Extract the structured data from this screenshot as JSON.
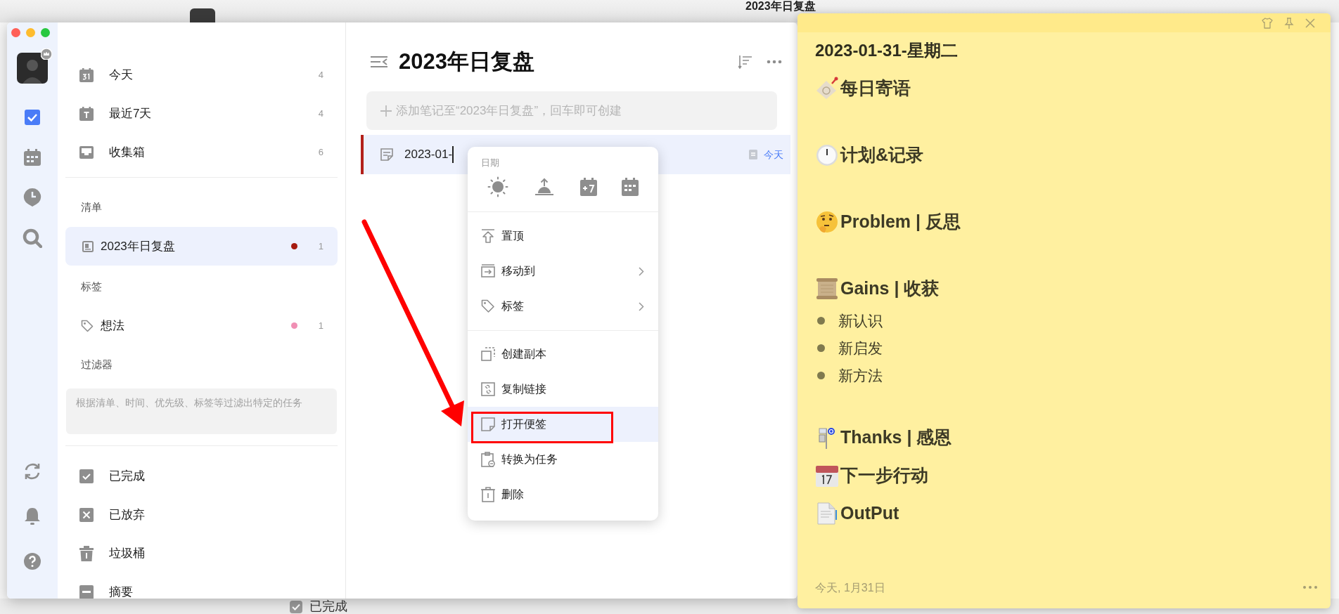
{
  "background_window": {
    "title": "2023年日复盘",
    "footer_item": {
      "label": "已完成",
      "checked": true
    }
  },
  "rail": {
    "items": [
      {
        "selected": true
      },
      {
        "selected": false
      },
      {
        "selected": false
      },
      {
        "selected": false
      }
    ]
  },
  "sidebar": {
    "smart_lists": [
      {
        "label": "今天",
        "count": "4",
        "selected": false
      },
      {
        "label": "最近7天",
        "count": "4",
        "selected": false
      },
      {
        "label": "收集箱",
        "count": "6",
        "selected": false
      }
    ],
    "lists_header": "清单",
    "lists": [
      {
        "label": "2023年日复盘",
        "count": "1",
        "color": "#a61b0f",
        "selected": true
      }
    ],
    "tags_header": "标签",
    "tags": [
      {
        "label": "想法",
        "count": "1",
        "color": "#f08fb4",
        "selected": false
      }
    ],
    "filters_header": "过滤器",
    "filter_hint": "根据清单、时间、优先级、标签等过滤出特定的任务",
    "system_lists": [
      {
        "label": "已完成",
        "selected": false
      },
      {
        "label": "已放弃",
        "selected": false
      },
      {
        "label": "垃圾桶",
        "selected": false
      },
      {
        "label": "摘要",
        "selected": false
      }
    ]
  },
  "list": {
    "title": "2023年日复盘",
    "add_placeholder": "添加笔记至“2023年日复盘”，回车即可创建",
    "notes": [
      {
        "title": "2023-01-",
        "date": "今天",
        "selected": true
      }
    ]
  },
  "context_menu": {
    "date_label": "日期",
    "groups": [
      {
        "items": [
          {
            "label": "置顶",
            "submenu": false,
            "selected": false
          },
          {
            "label": "移动到",
            "submenu": true,
            "selected": false
          },
          {
            "label": "标签",
            "submenu": true,
            "selected": false
          }
        ]
      },
      {
        "items": [
          {
            "label": "创建副本",
            "submenu": false,
            "selected": false
          },
          {
            "label": "复制链接",
            "submenu": false,
            "selected": false
          },
          {
            "label": "打开便签",
            "submenu": false,
            "selected": true
          },
          {
            "label": "转换为任务",
            "submenu": false,
            "selected": false
          },
          {
            "label": "删除",
            "submenu": false,
            "selected": false
          }
        ]
      }
    ]
  },
  "sticky_note": {
    "blocks": [
      {
        "kind": "title",
        "text": "2023-01-31-星期二"
      },
      {
        "kind": "heading",
        "text": "每日寄语"
      },
      {
        "kind": "blank"
      },
      {
        "kind": "heading",
        "text": "计划&记录"
      },
      {
        "kind": "blank"
      },
      {
        "kind": "heading",
        "text": "Problem | 反思"
      },
      {
        "kind": "blank"
      },
      {
        "kind": "heading",
        "text": "Gains | 收获"
      },
      {
        "kind": "bullet",
        "text": "新认识"
      },
      {
        "kind": "bullet",
        "text": "新启发"
      },
      {
        "kind": "bullet",
        "text": "新方法"
      },
      {
        "kind": "blank"
      },
      {
        "kind": "heading",
        "text": "Thanks | 感恩"
      },
      {
        "kind": "heading",
        "text": "下一步行动"
      },
      {
        "kind": "heading",
        "text": "OutPut"
      }
    ],
    "footer": "今天, 1月31日"
  }
}
